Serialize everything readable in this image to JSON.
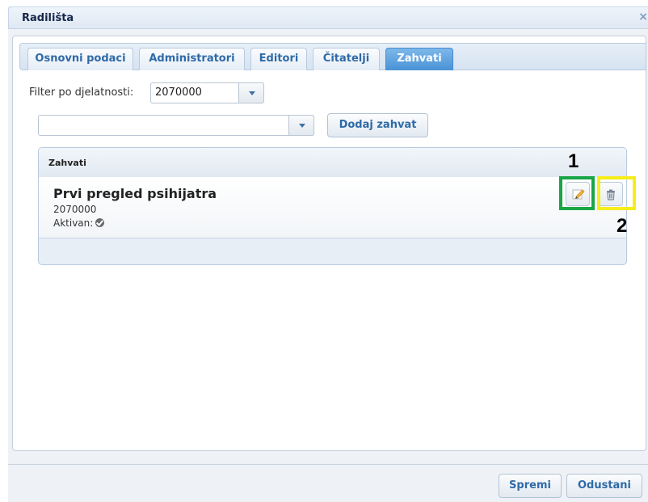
{
  "dialog": {
    "title": "Radilišta",
    "close_glyph": "×"
  },
  "tabs": [
    {
      "label": "Osnovni podaci"
    },
    {
      "label": "Administratori"
    },
    {
      "label": "Editori"
    },
    {
      "label": "Čitatelji"
    },
    {
      "label": "Zahvati",
      "active": true
    }
  ],
  "filter": {
    "label": "Filter po djelatnosti:",
    "value": "2070000"
  },
  "zahvat_select": {
    "value": ""
  },
  "add_button": {
    "label": "Dodaj zahvat"
  },
  "zahvati_panel": {
    "header": "Zahvati",
    "items": [
      {
        "title": "Prvi pregled psihijatra",
        "code": "2070000",
        "active_label": "Aktivan:",
        "active": true
      }
    ]
  },
  "annotations": {
    "edit_number": "1",
    "delete_number": "2",
    "edit_color": "#1aa546",
    "delete_color": "#f5ee1a"
  },
  "footer": {
    "save_label": "Spremi",
    "cancel_label": "Odustani"
  },
  "icons": {
    "edit": "pencil-icon",
    "delete": "trash-icon",
    "active": "check-circle-icon",
    "close": "close-icon"
  }
}
